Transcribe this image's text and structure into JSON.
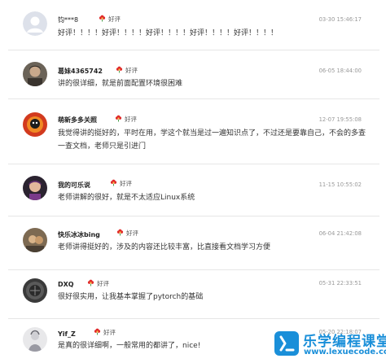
{
  "reviews": [
    {
      "username": "钧***8",
      "rating_label": "好评",
      "time": "03-30 15:46:17",
      "comment": "好评！！！！好评！！！！好评！！！！好评！！！！好评！！！！"
    },
    {
      "username": "葛妹4365742",
      "rating_label": "好评",
      "time": "06-05 18:44:00",
      "comment": "讲的很详细，就是前面配置环境很困难"
    },
    {
      "username": "萌新多多关照",
      "rating_label": "好评",
      "time": "12-07 19:55:08",
      "comment": "我觉得讲的挺好的，平时在用，学这个就当是过一遍知识点了，不过还是要靠自己，不会的多查一查文档，老师只是引进门"
    },
    {
      "username": "我的可乐说",
      "rating_label": "好评",
      "time": "11-15 10:55:02",
      "comment": "老师讲解的很好，就是不太适应Linux系统"
    },
    {
      "username": "快乐冰冰bing",
      "rating_label": "好评",
      "time": "06-04 21:42:08",
      "comment": "老师讲得挺好的，涉及的内容还比较丰富，比直接看文档学习方便"
    },
    {
      "username": "DXQ",
      "rating_label": "好评",
      "time": "05-31 22:33:51",
      "comment": "很好很实用，让我基本掌握了pytorch的基础"
    },
    {
      "username": "Yif_Z",
      "rating_label": "好评",
      "time": "05-20 22:18:07",
      "comment": "是真的很详细啊，一般常用的都讲了，nice!"
    }
  ],
  "watermark": {
    "brand": "乐学编程课堂",
    "domain": "www.lexuecode.com"
  },
  "colors": {
    "flower": "#e02b2b",
    "watermark": "#1a8fd9",
    "divider": "#e6e6e6"
  },
  "icons": {
    "rating": "red-flower-icon",
    "avatar_default": "default-user-avatar-icon",
    "brand_logo": "lexuecode-logo-icon"
  }
}
